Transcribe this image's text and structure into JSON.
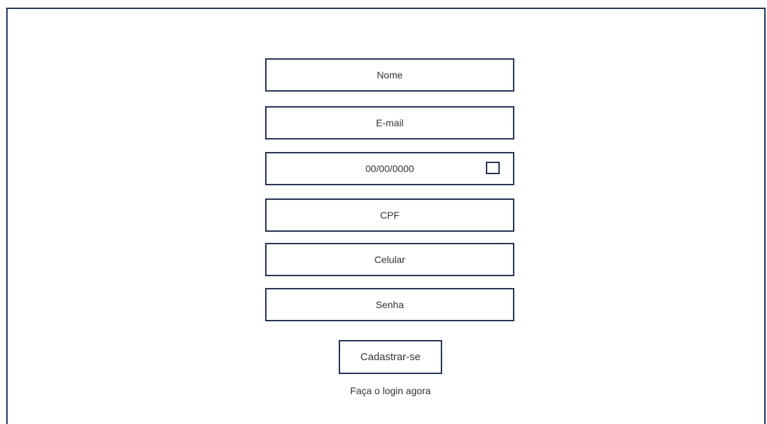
{
  "form": {
    "fields": [
      {
        "placeholder": "Nome"
      },
      {
        "placeholder": "E-mail"
      },
      {
        "placeholder": "00/00/0000"
      },
      {
        "placeholder": "CPF"
      },
      {
        "placeholder": "Celular"
      },
      {
        "placeholder": "Senha"
      }
    ],
    "submit_label": "Cadastrar-se",
    "login_link": "Faça o login agora"
  },
  "colors": {
    "border": "#22325f",
    "text": "#333333",
    "background": "#ffffff"
  },
  "icons": {
    "date_checkbox": "checkbox-icon"
  }
}
